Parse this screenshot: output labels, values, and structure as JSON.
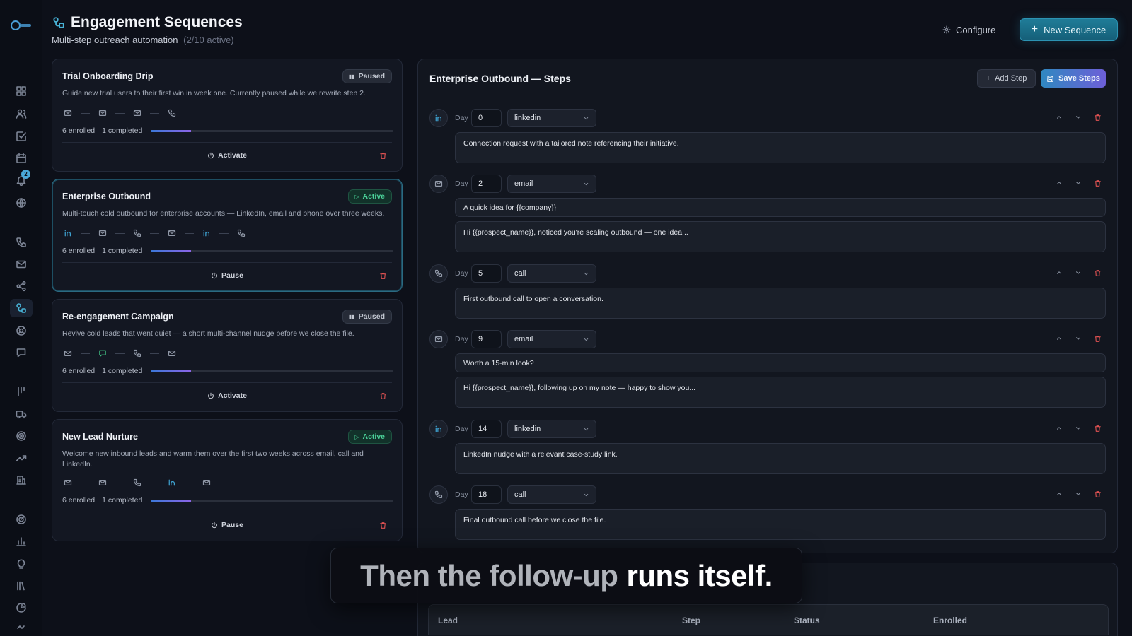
{
  "header": {
    "title": "Engagement Sequences",
    "subtitle": "Multi-step outreach automation",
    "subtitle_count": "(2/10 active)",
    "configure_label": "Configure",
    "new_sequence_label": "New Sequence"
  },
  "sidebar": {
    "notification_count": "2",
    "icons": [
      "grid-icon",
      "users-icon",
      "check-square-icon",
      "calendar-icon",
      "bell-icon",
      "globe-icon",
      "phone-icon",
      "mail-icon",
      "share-icon",
      "sequence-icon",
      "lifebuoy-icon",
      "chat-icon",
      "columns-icon",
      "truck-icon",
      "target-icon",
      "trending-icon",
      "building-icon",
      "radar-icon",
      "bar-chart-icon",
      "bulb-icon",
      "library-icon",
      "pie-icon"
    ]
  },
  "sequences": [
    {
      "name": "Trial Onboarding Drip",
      "status": "Paused",
      "description": "Guide new trial users to their first win in week one. Currently paused while we rewrite step 2.",
      "channels": [
        "email",
        "email",
        "email",
        "call"
      ],
      "enrolled": "6 enrolled",
      "completed": "1 completed",
      "progress": 0.167,
      "action": "Activate"
    },
    {
      "name": "Enterprise Outbound",
      "status": "Active",
      "description": "Multi-touch cold outbound for enterprise accounts — LinkedIn, email and phone over three weeks.",
      "channels": [
        "linkedin",
        "email",
        "call",
        "email",
        "linkedin",
        "call"
      ],
      "enrolled": "6 enrolled",
      "completed": "1 completed",
      "progress": 0.167,
      "action": "Pause"
    },
    {
      "name": "Re-engagement Campaign",
      "status": "Paused",
      "description": "Revive cold leads that went quiet — a short multi-channel nudge before we close the file.",
      "channels": [
        "email",
        "sms",
        "call",
        "email"
      ],
      "enrolled": "6 enrolled",
      "completed": "1 completed",
      "progress": 0.167,
      "action": "Activate"
    },
    {
      "name": "New Lead Nurture",
      "status": "Active",
      "description": "Welcome new inbound leads and warm them over the first two weeks across email, call and LinkedIn.",
      "channels": [
        "email",
        "email",
        "call",
        "linkedin",
        "email"
      ],
      "enrolled": "6 enrolled",
      "completed": "1 completed",
      "progress": 0.167,
      "action": "Pause"
    }
  ],
  "steps_panel": {
    "title": "Enterprise Outbound — Steps",
    "add_step_label": "Add Step",
    "save_steps_label": "Save Steps",
    "day_label": "Day",
    "steps": [
      {
        "day": "0",
        "channel": "linkedin",
        "body": "Connection request with a tailored note referencing their initiative."
      },
      {
        "day": "2",
        "channel": "email",
        "subject": "A quick idea for {{company}}",
        "body": "Hi {{prospect_name}}, noticed you're scaling outbound — one idea..."
      },
      {
        "day": "5",
        "channel": "call",
        "body": "First outbound call to open a conversation."
      },
      {
        "day": "9",
        "channel": "email",
        "subject": "Worth a 15-min look?",
        "body": "Hi {{prospect_name}}, following up on my note — happy to show you..."
      },
      {
        "day": "14",
        "channel": "linkedin",
        "body": "LinkedIn nudge with a relevant case-study link."
      },
      {
        "day": "18",
        "channel": "call",
        "body": "Final outbound call before we close the file."
      }
    ]
  },
  "enrollments": {
    "columns": [
      "Lead",
      "Step",
      "Status",
      "Enrolled"
    ]
  },
  "caption": {
    "part1": "Then the follow-up",
    "part2": "runs itself."
  }
}
